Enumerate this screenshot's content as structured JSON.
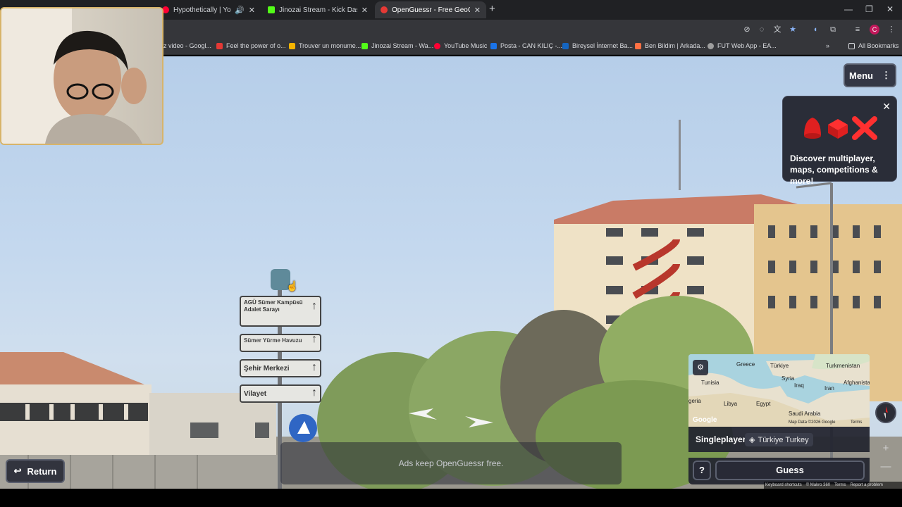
{
  "browser": {
    "tabs": [
      {
        "title": "Hypothetically | YouTube Mus",
        "active": false,
        "favicon_color": "#ff0033"
      },
      {
        "title": "Jinozai Stream - Kick Dashboard",
        "active": false,
        "favicon_color": "#53fc18"
      },
      {
        "title": "OpenGuessr - Free GeoGuessr A",
        "active": true,
        "favicon_color": "#e53935"
      }
    ],
    "bookmarks": [
      {
        "label": "z video - Googl...",
        "color": "#4285f4"
      },
      {
        "label": "Feel the power of o...",
        "color": "#e53935"
      },
      {
        "label": "Trouver un monume...",
        "color": "#f4b400"
      },
      {
        "label": "Jinozai Stream - Wa...",
        "color": "#53fc18"
      },
      {
        "label": "YouTube Music",
        "color": "#ff0033"
      },
      {
        "label": "Posta - CAN KILIÇ -...",
        "color": "#1a73e8"
      },
      {
        "label": "Bireysel İnternet Ba...",
        "color": "#1565c0"
      },
      {
        "label": "Ben Bildim | Arkada...",
        "color": "#ff7043"
      },
      {
        "label": "FUT Web App - EA...",
        "color": "#9e9e9e"
      }
    ],
    "all_bookmarks_label": "All Bookmarks",
    "profile_initial": "C"
  },
  "game": {
    "menu_label": "Menu",
    "promo": {
      "text": "Discover multiplayer, maps, competitions & more!"
    },
    "return_label": "Return",
    "ads_text": "Ads keep OpenGuessr free.",
    "mode_label": "Singleplayer",
    "map_label": "Türkiye Turkey",
    "guess_label": "Guess",
    "help_label": "?",
    "minimap": {
      "labels": [
        "Greece",
        "Türkiye",
        "Turkmenistan",
        "Tunisia",
        "Syria",
        "Afghanista",
        "Iraq",
        "Iran",
        "Libya",
        "Egypt",
        "Saudi Arabia",
        "geria"
      ],
      "attribution": "Map Data ©2026 Google",
      "terms": "Terms",
      "google": "Google"
    },
    "footer": {
      "shortcuts": "Keyboard shortcuts",
      "copyright": "© Makro 360",
      "terms": "Terms",
      "report": "Report a problem"
    }
  },
  "scene": {
    "signs": [
      "AGÜ Sümer Kampüsü Adalet Sarayı",
      "Sümer Yürme Havuzu",
      "Şehir Merkezi",
      "Vilayet"
    ]
  },
  "colors": {
    "accent_red": "#e02020",
    "panel_bg": "#24262f",
    "sign_blue": "#1f5fbf"
  }
}
